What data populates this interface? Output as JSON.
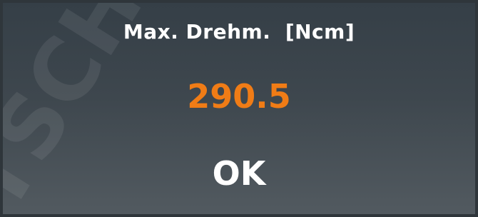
{
  "display": {
    "title": "Max. Drehm.  [Ncm]",
    "value": "290.5",
    "status": "OK"
  },
  "watermark": {
    "text": "TSCH"
  },
  "colors": {
    "background_top": "#353f47",
    "background_bottom": "#525a60",
    "value_color": "#f07c16",
    "text_color": "#ffffff"
  }
}
